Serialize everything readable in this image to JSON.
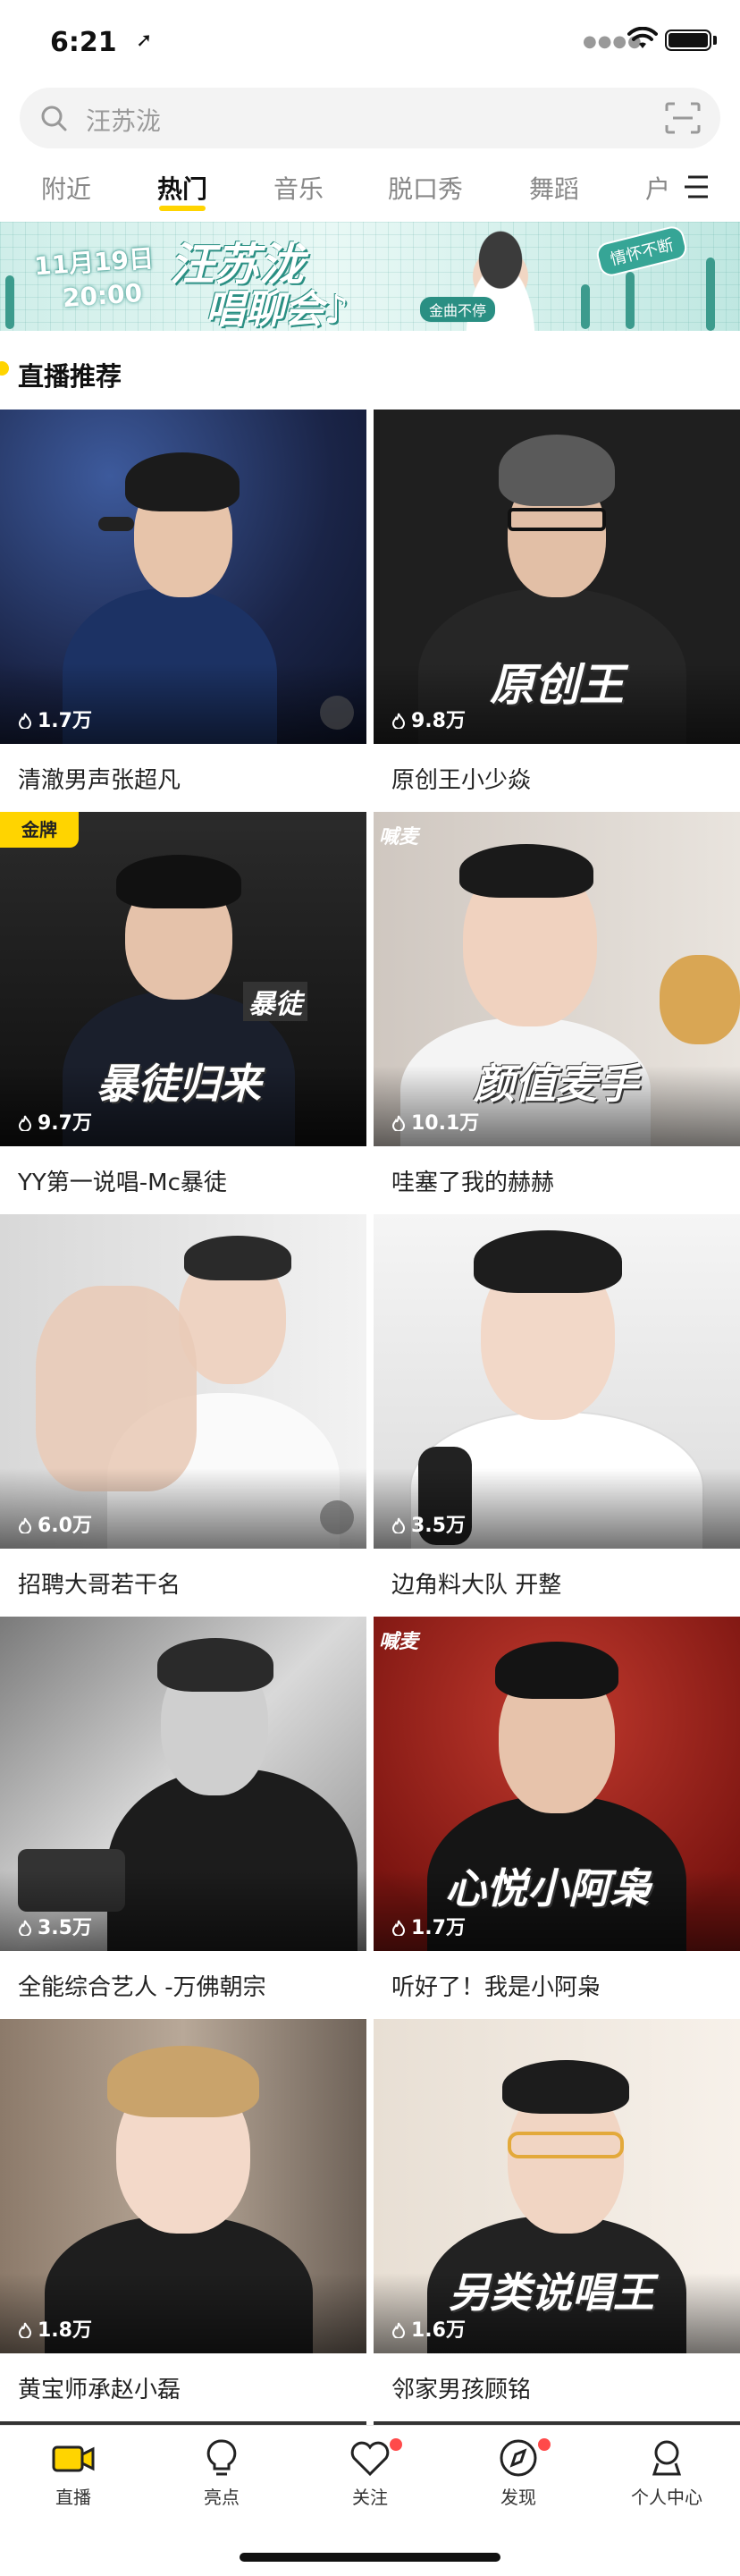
{
  "status_bar": {
    "time": "6:21",
    "location_arrow": "➚"
  },
  "search": {
    "placeholder": "汪苏泷"
  },
  "tabs": [
    {
      "label": "附近",
      "active": false
    },
    {
      "label": "热门",
      "active": true
    },
    {
      "label": "音乐",
      "active": false
    },
    {
      "label": "脱口秀",
      "active": false
    },
    {
      "label": "舞蹈",
      "active": false
    },
    {
      "label": "户",
      "active": false
    }
  ],
  "banner": {
    "date": "11月19日",
    "time": "20:00",
    "name": "汪苏泷",
    "subtitle": "唱聊会♪",
    "tag_bottom": "金曲不停",
    "tag_top": "情怀不断"
  },
  "section": {
    "title": "直播推荐"
  },
  "cards": [
    {
      "title": "清澈男声张超凡",
      "viewers": "1.7万",
      "has_mic_icon": true
    },
    {
      "title": "原创王小少焱",
      "viewers": "9.8万",
      "overlay": "原创王"
    },
    {
      "title": "YY第一说唱-Mc暴徒",
      "viewers": "9.7万",
      "badge": "金牌",
      "overlay": "暴徒归来",
      "overlay_small": "暴徒"
    },
    {
      "title": "哇塞了我的赫赫",
      "viewers": "10.1万",
      "overlay": "颜值麦手",
      "watermark": "喊麦"
    },
    {
      "title": "招聘大哥若干名",
      "viewers": "6.0万",
      "has_mic_icon": true
    },
    {
      "title": "边角料大队 开整",
      "viewers": "3.5万"
    },
    {
      "title": "全能综合艺人 -万佛朝宗",
      "viewers": "3.5万"
    },
    {
      "title": "听好了！我是小阿枭",
      "viewers": "1.7万",
      "overlay": "心悦小阿枭",
      "watermark": "喊麦"
    },
    {
      "title": "黄宝师承赵小磊",
      "viewers": "1.8万"
    },
    {
      "title": "邻家男孩顾铭",
      "viewers": "1.6万",
      "overlay": "另类说唱王"
    }
  ],
  "bottom_nav": [
    {
      "label": "直播",
      "icon": "live-camera-icon",
      "active": true,
      "dot": false
    },
    {
      "label": "亮点",
      "icon": "lightbulb-icon",
      "active": false,
      "dot": false
    },
    {
      "label": "关注",
      "icon": "heart-icon",
      "active": false,
      "dot": true
    },
    {
      "label": "发现",
      "icon": "compass-icon",
      "active": false,
      "dot": true
    },
    {
      "label": "个人中心",
      "icon": "profile-icon",
      "active": false,
      "dot": false
    }
  ],
  "colors": {
    "accent": "#ffd400",
    "badge_red": "#ff4a4a",
    "banner_teal": "#2a8f83"
  }
}
